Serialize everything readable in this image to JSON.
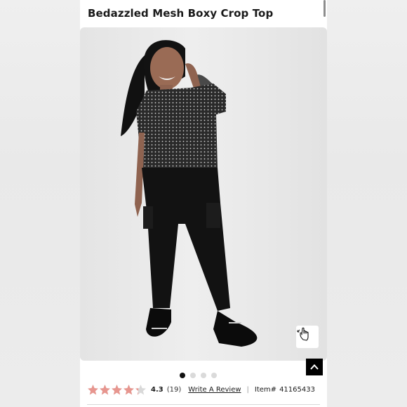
{
  "product": {
    "title": "Bedazzled Mesh Boxy Crop Top"
  },
  "gallery": {
    "slide_count": 4,
    "active_slide": 1,
    "zoom_icon": "hand-zoom-icon",
    "scroll_top_icon": "chevron-up-icon"
  },
  "rating": {
    "value": "4.3",
    "stars_fraction": 0.86,
    "reviews": "(19)",
    "write_review": "Write A Review",
    "separator": "|",
    "item_label": "Item#",
    "item_number": "41165433",
    "star_color": "#e7968f",
    "star_empty_color": "#d9d9d9"
  },
  "colors": {
    "background": "#ffffff",
    "accent_dark": "#000000"
  }
}
